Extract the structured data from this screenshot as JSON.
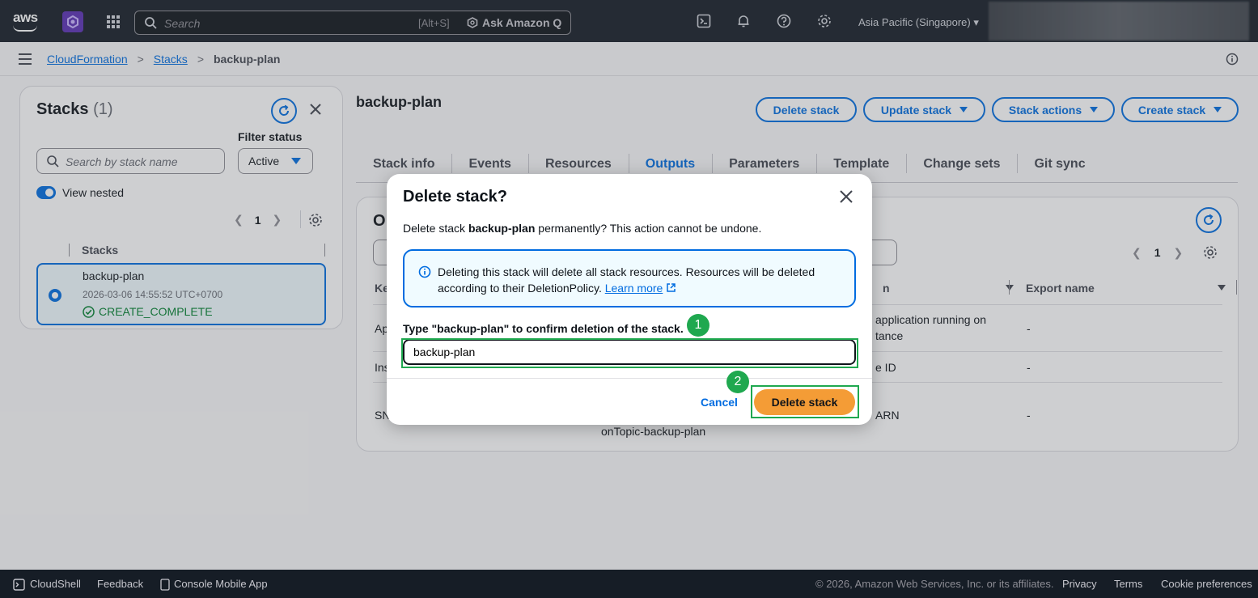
{
  "topnav": {
    "logo": "aws",
    "search_placeholder": "Search",
    "search_shortcut": "[Alt+S]",
    "ask_q": "Ask Amazon Q",
    "region": "Asia Pacific (Singapore) ▾",
    "icons": [
      "cloudshell-icon",
      "bell-icon",
      "help-icon",
      "gear-icon"
    ]
  },
  "breadcrumb": {
    "items": [
      "CloudFormation",
      "Stacks"
    ],
    "current": "backup-plan",
    "separator": ">"
  },
  "left_panel": {
    "title": "Stacks",
    "count": "(1)",
    "filter_label": "Filter status",
    "filter_value": "Active",
    "search_placeholder": "Search by stack name",
    "view_nested": "View nested",
    "page": "1",
    "column": "Stacks",
    "stack": {
      "name": "backup-plan",
      "date": "2026-03-06 14:55:52 UTC+0700",
      "status": "CREATE_COMPLETE"
    }
  },
  "main": {
    "title": "backup-plan",
    "buttons": {
      "delete": "Delete stack",
      "update": "Update stack",
      "actions": "Stack actions",
      "create": "Create stack"
    },
    "tabs": [
      "Stack info",
      "Events",
      "Resources",
      "Outputs",
      "Parameters",
      "Template",
      "Change sets",
      "Git sync"
    ],
    "active_tab": "Outputs",
    "outputs": {
      "title_fragment": "O",
      "page": "1",
      "col_key": "Ke",
      "col_desc": "n",
      "col_export": "Export name",
      "rows": [
        {
          "key": "Ap",
          "desc1": "application running on",
          "desc2": "tance",
          "export": "-"
        },
        {
          "key": "Ins",
          "desc1": "e ID",
          "export": "-"
        },
        {
          "key": "SN",
          "value_fragment": "onTopic-backup-plan",
          "desc1": "ARN",
          "export": "-"
        }
      ]
    }
  },
  "modal": {
    "title": "Delete stack?",
    "desc_prefix": "Delete stack ",
    "desc_name": "backup-plan",
    "desc_suffix": " permanently? This action cannot be undone.",
    "alert_text": "Deleting this stack will delete all stack resources. Resources will be deleted according to their DeletionPolicy.",
    "alert_link": "Learn more",
    "confirm_label": "Type \"backup-plan\" to confirm deletion of the stack.",
    "confirm_value": "backup-plan",
    "cancel": "Cancel",
    "delete": "Delete stack",
    "step1": "1",
    "step2": "2"
  },
  "footer": {
    "cloudshell": "CloudShell",
    "feedback": "Feedback",
    "mobile": "Console Mobile App",
    "copyright": "© 2026, Amazon Web Services, Inc. or its affiliates.",
    "privacy": "Privacy",
    "terms": "Terms",
    "cookies": "Cookie preferences"
  },
  "colors": {
    "accent": "#006ce0",
    "primary_button": "#f49c36",
    "success": "#00802f",
    "annotation": "#1fa84f",
    "topnav": "#161d26"
  }
}
